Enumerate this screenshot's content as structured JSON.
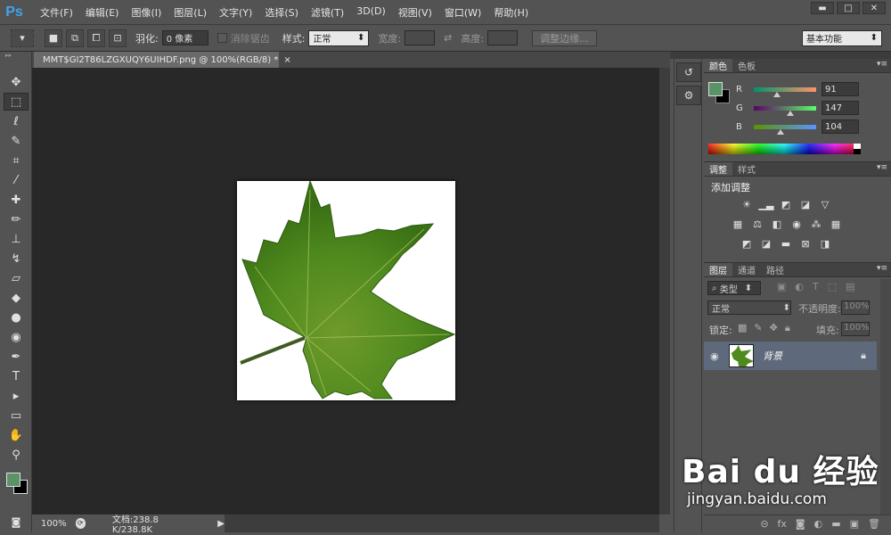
{
  "app": {
    "logo": "Ps"
  },
  "menu": [
    "文件(F)",
    "编辑(E)",
    "图像(I)",
    "图层(L)",
    "文字(Y)",
    "选择(S)",
    "滤镜(T)",
    "3D(D)",
    "视图(V)",
    "窗口(W)",
    "帮助(H)"
  ],
  "window_buttons": {
    "minimize": "▬",
    "maximize": "□",
    "close": "✕"
  },
  "options": {
    "feather_label": "羽化:",
    "feather_value": "0 像素",
    "antialias_label": "消除锯齿",
    "style_label": "样式:",
    "style_value": "正常",
    "width_label": "宽度:",
    "height_label": "高度:",
    "refine_edge": "调整边缘...",
    "workspace": "基本功能"
  },
  "document": {
    "tab_title": "MMT$GI2T86LZGXUQY6UIHDF.png @ 100%(RGB/8) *",
    "close": "×"
  },
  "status": {
    "zoom": "100%",
    "doc_info": "文档:238.8 K/238.8K"
  },
  "colors": {
    "foreground": "#5b9368",
    "background": "#000000",
    "r_value": "91",
    "g_value": "147",
    "b_value": "104"
  },
  "color_panel": {
    "tab_color": "颜色",
    "tab_swatches": "色板",
    "r": "R",
    "g": "G",
    "b": "B"
  },
  "adjust_panel": {
    "tab_adjust": "调整",
    "tab_styles": "样式",
    "title": "添加调整"
  },
  "layers_panel": {
    "tab_layers": "图层",
    "tab_channels": "通道",
    "tab_paths": "路径",
    "filter_kind": "类型",
    "blend_mode": "正常",
    "opacity_label": "不透明度:",
    "opacity_value": "100%",
    "lock_label": "锁定:",
    "fill_label": "填充:",
    "fill_value": "100%",
    "layer_name": "背景"
  },
  "watermark": {
    "main": "Bai du 经验",
    "sub": "jingyan.baidu.com"
  }
}
